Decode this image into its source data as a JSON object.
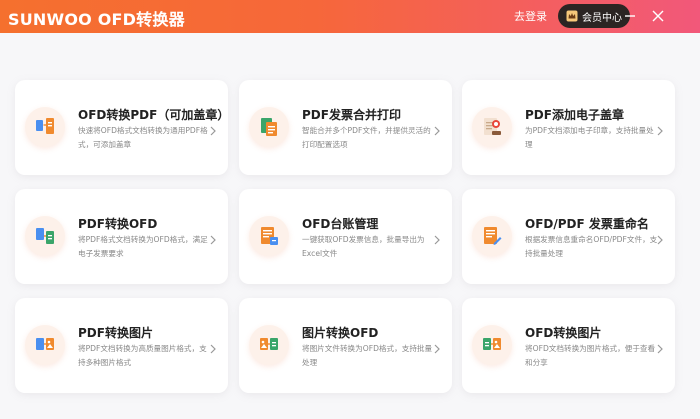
{
  "app": {
    "brand": "SUNWOO",
    "title": "OFD转换器",
    "login_label": "去登录",
    "member_label": "会员中心"
  },
  "colors": {
    "accent_orange": "#f5702e",
    "accent_pink": "#f2587a",
    "member_button": "#2b2523"
  },
  "cards": [
    {
      "title": "OFD转换PDF（可加盖章）",
      "desc": "快速将OFD格式文档转换为通用PDF格式，可添加盖章",
      "icon": "ofd-to-pdf-icon"
    },
    {
      "title": "PDF发票合并打印",
      "desc": "智能合并多个PDF文件，并提供灵活的打印配置选项",
      "icon": "merge-print-icon"
    },
    {
      "title": "PDF添加电子盖章",
      "desc": "为PDF文档添加电子印章，支持批量处理",
      "icon": "stamp-icon"
    },
    {
      "title": "PDF转换OFD",
      "desc": "将PDF格式文档转换为OFD格式，满足电子发票要求",
      "icon": "pdf-to-ofd-icon"
    },
    {
      "title": "OFD台账管理",
      "desc": "一键获取OFD发票信息，批量导出为Excel文件",
      "icon": "ledger-icon"
    },
    {
      "title": "OFD/PDF 发票重命名",
      "desc": "根据发票信息重命名OFD/PDF文件，支持批量处理",
      "icon": "rename-icon"
    },
    {
      "title": "PDF转换图片",
      "desc": "将PDF文档转换为高质量图片格式，支持多种图片格式",
      "icon": "pdf-to-image-icon"
    },
    {
      "title": "图片转换OFD",
      "desc": "将图片文件转换为OFD格式，支持批量处理",
      "icon": "image-to-ofd-icon"
    },
    {
      "title": "OFD转换图片",
      "desc": "将OFD文档转换为图片格式，便于查看和分享",
      "icon": "ofd-to-image-icon"
    }
  ]
}
